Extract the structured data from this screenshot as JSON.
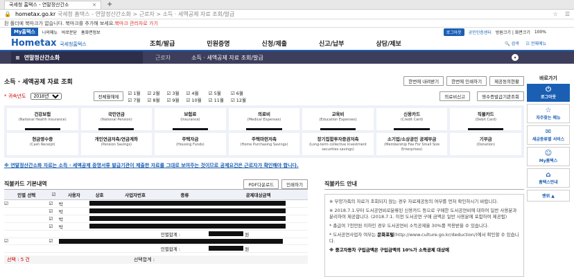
{
  "browser": {
    "tab_title": "국세청 홈택스 - 연말정산간소",
    "tab_close": "×",
    "new_tab": "+",
    "url_host": "hometax.go.kr",
    "url_path": "국세청 홈택스 - 연말정산간소화 > 근로자 > 소득 · 세액공제 자료 조회/발급",
    "bookmark_msg": "된 폴더에 북마크가 없습니다. 북마크를 추가해 보세요.",
    "bookmark_link": "북마크 관리자로 가기"
  },
  "topbar": {
    "my": "My홈택스",
    "star": "나의메뉴",
    "guide": "바로문닫",
    "info": "홈화면정보",
    "login": "로그아웃",
    "cert": "공인인증센터",
    "size": "방원크기 | 화면크기",
    "zoom": "100%"
  },
  "nav": {
    "logo": "Hometax",
    "logo_sub": "국세청홈택스",
    "items": [
      "조회/발급",
      "민원증명",
      "신청/제출",
      "신고/납부",
      "상담/제보"
    ],
    "search": "검색",
    "all": "전체메뉴"
  },
  "band": {
    "menu": "연말정산간소화",
    "crumbs": [
      "근로자",
      "소득 · 세액공제 자료 조회/발급"
    ]
  },
  "page": {
    "title": "소득 · 세액공제 자료 조회",
    "btn_download": "한번에 내려받기",
    "btn_print": "한번에 인쇄하기",
    "btn_status": "제공동의현황",
    "year_label": "귀속년도",
    "year": "2018년",
    "btn_all": "전체월해제",
    "months_row1": [
      "1월",
      "2월",
      "3월",
      "4월",
      "5월",
      "6월"
    ],
    "months_row2": [
      "7월",
      "8월",
      "9월",
      "10월",
      "11월",
      "12월"
    ],
    "btn_medical": "의료비신고",
    "btn_receipt": "영수증발급기관조회",
    "notice": "※ 연말정산간소화 자료는 소득 · 세액공제 증명서류 발급기관이 제출한 자료를 그대로 보여주는 것이므로 공제요건은 근로자가 확인해야 합니다."
  },
  "cards": [
    {
      "ko": "건강보험",
      "en": "(National Health Insurance)"
    },
    {
      "ko": "국민연금",
      "en": "(National Pension)"
    },
    {
      "ko": "보험료",
      "en": "(Insurance)"
    },
    {
      "ko": "의료비",
      "en": "(Medical Expenses)"
    },
    {
      "ko": "교육비",
      "en": "(Education Expenses)"
    },
    {
      "ko": "신용카드",
      "en": "(Credit Card)"
    },
    {
      "ko": "직불카드",
      "en": "(Debit Card)"
    },
    {
      "ko": "현금영수증",
      "en": "(Cash Receipt)"
    },
    {
      "ko": "개인연금저축/연금계좌",
      "en": "(Pension Savings)"
    },
    {
      "ko": "주택자금",
      "en": "(Housing Funds)"
    },
    {
      "ko": "주택마련저축",
      "en": "(Home Purchasing Savings)"
    },
    {
      "ko": "장기집합투자증권저축",
      "en": "(Long-term collective investment securities savings)"
    },
    {
      "ko": "소기업/소상공인 공제부금",
      "en": "(Membership Fee For Small Size Enterprises)"
    },
    {
      "ko": "기부금",
      "en": "(Donation)"
    }
  ],
  "left": {
    "title": "직불카드 기본내역",
    "btn_pdf": "PDF다운로드",
    "btn_print": "인쇄하기",
    "cols": [
      "인별 선택",
      "",
      "사용자",
      "상호",
      "사업자번호",
      "종류",
      "공제대상금액"
    ],
    "row_prefix": "박",
    "subtotal": "인별합계 :",
    "won": "원",
    "selected": "선택 : 5 건",
    "sel_total": "선택합계 :"
  },
  "right": {
    "title": "직불카드 안내",
    "p1": "※ 부양가족의 자료가 조회되지 않는 경우 자료제공동의 여부를 먼저 확인하시기 바랍니다.",
    "p2": "※ 2018.7.1.부터 도서공연비로분류된 신용카드 등으로 구매한 도서공연비에 대하여 일반 사용분과 분리하여 제공합니다. (2018.7.1. 이전 도서공연 구매 금액은 일반 사용분에 포함하여 제공됨)",
    "p3": "* 총급여 7천만원 이하인 경우 도서공연비 소득공제율 30%를 적용받을 수 있습니다.",
    "p4a": "* 도서공연사업자 여부는 ",
    "p4b": "문화포털",
    "p4c": "(http://www.culture.go.kr/deduction/)에서 확인할 수 있습니다.",
    "p5": "※ 중고자동차 구입금액은 구입금액의 10%가 소득공제 대상에"
  },
  "quick": {
    "title": "바로가기",
    "items": [
      "로그아웃",
      "자주찾는 메뉴",
      "세금종류별 서비스",
      "My홈택스",
      "홈택스안내"
    ],
    "top": "맨위"
  }
}
